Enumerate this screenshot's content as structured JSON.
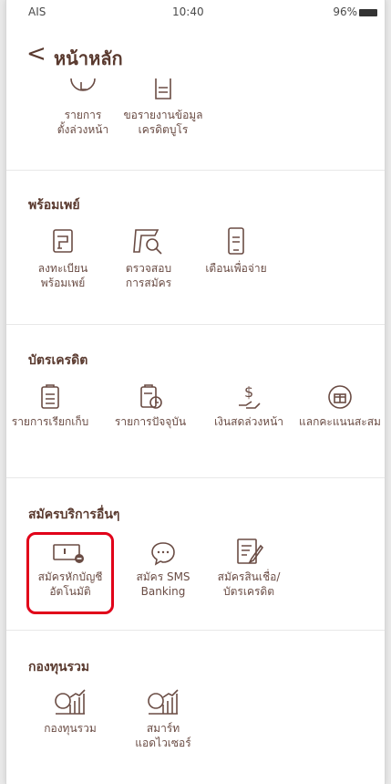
{
  "status": {
    "carrier": "AIS",
    "time": "10:40",
    "battery": "96%"
  },
  "header": {
    "back_label": "<",
    "title": "หน้าหลัก"
  },
  "top_items": [
    {
      "label": "รายการ\nตั้งล่วงหน้า"
    },
    {
      "label": "ขอรายงานข้อมูล\nเครดิตบูโร"
    }
  ],
  "sections": {
    "promptpay": {
      "title": "พร้อมเพย์",
      "items": [
        {
          "label": "ลงทะเบียน\nพร้อมเพย์"
        },
        {
          "label": "ตรวจสอบ\nการสมัคร"
        },
        {
          "label": "เตือนเพื่อจ่าย"
        }
      ]
    },
    "credit_card": {
      "title": "บัตรเครดิต",
      "items": [
        {
          "label": "รายการเรียกเก็บ"
        },
        {
          "label": "รายการปัจจุบัน"
        },
        {
          "label": "เงินสดล่วงหน้า"
        },
        {
          "label": "แลกคะแนนสะสม"
        }
      ]
    },
    "other_services": {
      "title": "สมัครบริการอื่นๆ",
      "items": [
        {
          "label": "สมัครหักบัญชี\nอัตโนมัติ"
        },
        {
          "label": "สมัคร SMS\nBanking"
        },
        {
          "label": "สมัครสินเชื่อ/\nบัตรเครดิต"
        }
      ]
    },
    "mutual_fund": {
      "title": "กองทุนรวม",
      "items": [
        {
          "label": "กองทุนรวม"
        },
        {
          "label": "สมาร์ท\nแอดไวเซอร์"
        }
      ]
    }
  },
  "colors": {
    "brand_brown": "#5a3a2f",
    "highlight_red": "#e10019"
  }
}
